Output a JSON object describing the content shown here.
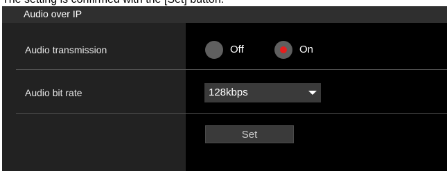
{
  "top_note": "The setting is confirmed with the [Set] button.",
  "section": {
    "title": "Audio over IP"
  },
  "audio_transmission": {
    "label": "Audio transmission",
    "options": [
      {
        "label": "Off",
        "selected": false
      },
      {
        "label": "On",
        "selected": true
      }
    ]
  },
  "audio_bit_rate": {
    "label": "Audio bit rate",
    "selected_value": "128kbps"
  },
  "set_button": {
    "label": "Set"
  },
  "colors": {
    "accent_radio_selected": "#e61e1e",
    "panel_background": "#000000",
    "left_column": "#222222",
    "header": "#2f2f2f"
  },
  "icons": {
    "dropdown": "chevron-down-icon"
  }
}
